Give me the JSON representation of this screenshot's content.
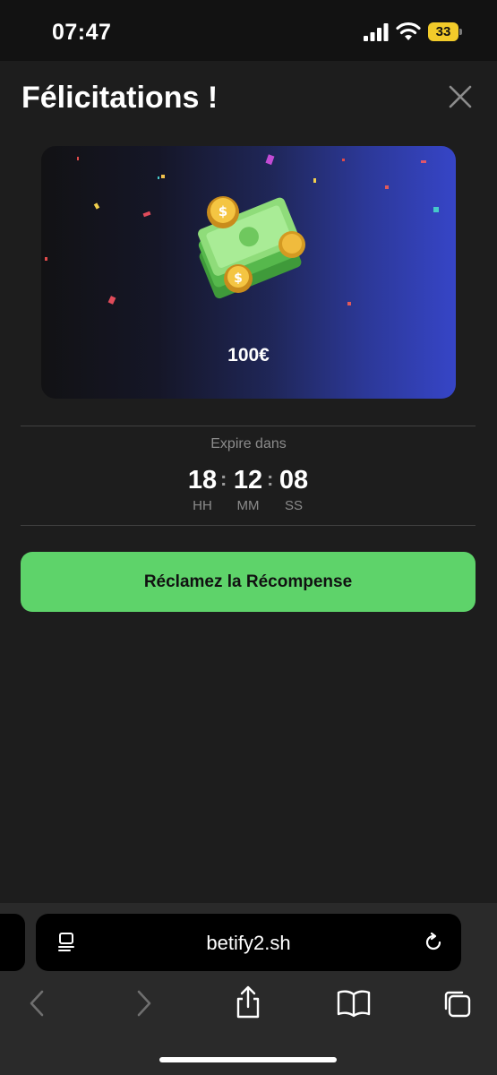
{
  "status_bar": {
    "time": "07:47",
    "battery": "33"
  },
  "header": {
    "title": "Félicitations !"
  },
  "reward": {
    "amount": "100€"
  },
  "countdown": {
    "label": "Expire dans",
    "hours": "18",
    "hours_label": "HH",
    "minutes": "12",
    "minutes_label": "MM",
    "seconds": "08",
    "seconds_label": "SS"
  },
  "cta": {
    "label": "Réclamez la Récompense"
  },
  "browser": {
    "url": "betify2.sh"
  },
  "colors": {
    "accent": "#5ed36a",
    "background": "#1d1d1d",
    "banner_start": "#121214",
    "banner_end": "#3645c7"
  }
}
